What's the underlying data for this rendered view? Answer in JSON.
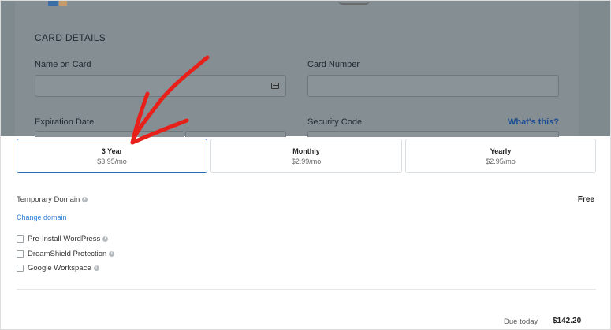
{
  "card_details": {
    "title": "CARD DETAILS",
    "name_on_card_label": "Name on Card",
    "card_number_label": "Card Number",
    "expiration_label": "Expiration Date",
    "security_code_label": "Security Code",
    "whats_this": "What's this?"
  },
  "plans": [
    {
      "name": "3 Year",
      "price": "$3.95/mo",
      "selected": true
    },
    {
      "name": "Monthly",
      "price": "$2.99/mo",
      "selected": false
    },
    {
      "name": "Yearly",
      "price": "$2.95/mo",
      "selected": false
    }
  ],
  "domain": {
    "label": "Temporary Domain",
    "price": "Free",
    "change_link": "Change domain"
  },
  "addons": [
    {
      "label": "Pre-Install WordPress",
      "checked": false
    },
    {
      "label": "DreamShield Protection",
      "checked": false
    },
    {
      "label": "Google Workspace",
      "checked": false
    }
  ],
  "summary": {
    "due_label": "Due today",
    "due_amount": "$142.20"
  },
  "colors": {
    "accent": "#2b6cb0",
    "link": "#2b7bd6",
    "annotation_arrow": "#e8201a",
    "overlay": "#7f8a8f"
  },
  "icons": {
    "card": "credit-card-icon",
    "info": "info-icon",
    "annotation": "red-arrow-annotation"
  }
}
